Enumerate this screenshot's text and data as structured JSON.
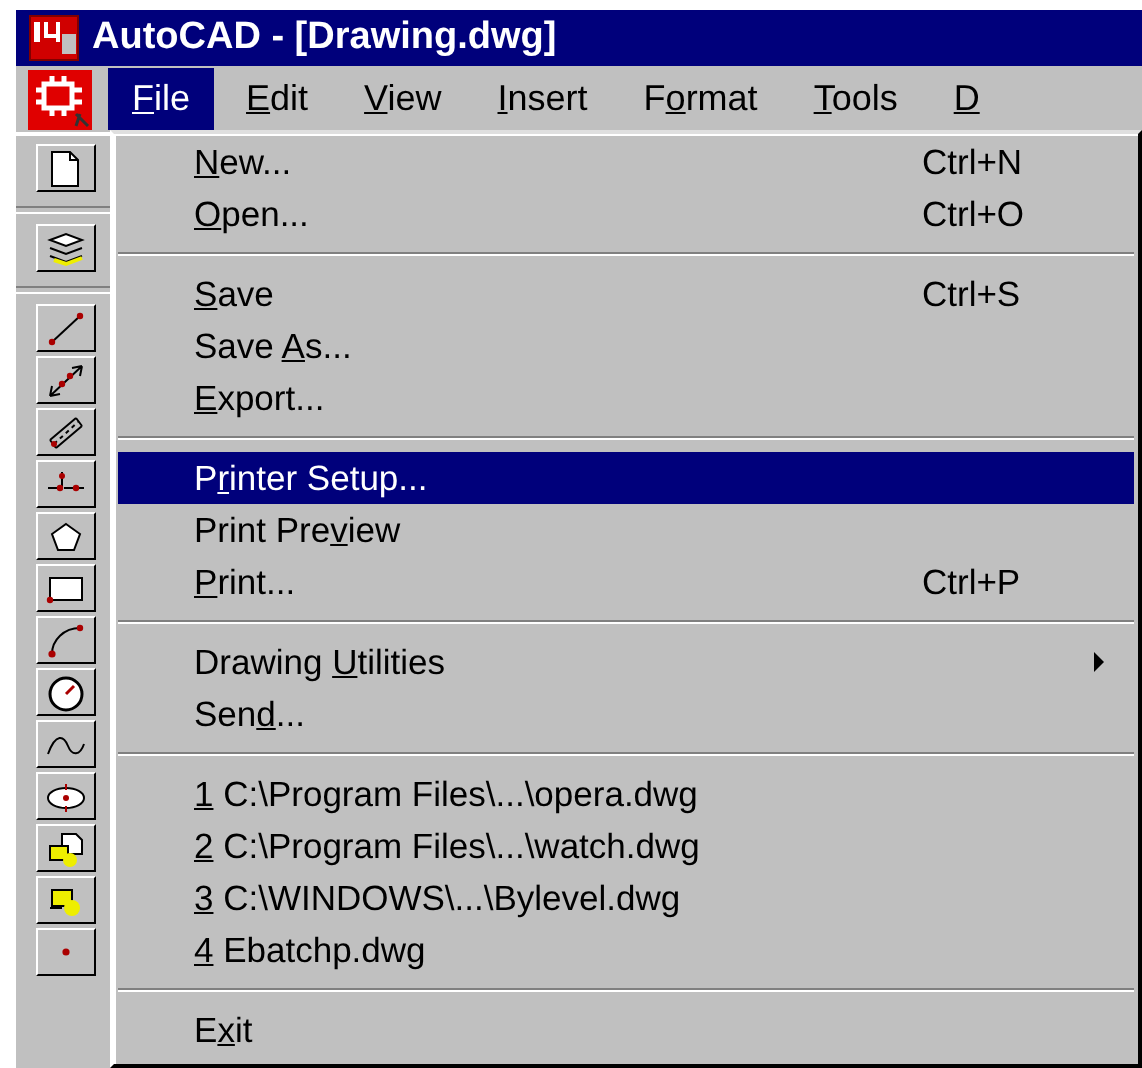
{
  "window": {
    "title": "AutoCAD - [Drawing.dwg]"
  },
  "menu_bar": [
    {
      "label": {
        "key": "F",
        "after": "ile"
      },
      "selected": true
    },
    {
      "label": {
        "key": "E",
        "after": "dit"
      },
      "selected": false
    },
    {
      "label": {
        "key": "V",
        "after": "iew"
      },
      "selected": false
    },
    {
      "label": {
        "key": "I",
        "after": "nsert"
      },
      "selected": false
    },
    {
      "label": {
        "before": "F",
        "key": "o",
        "after": "rmat"
      },
      "selected": false
    },
    {
      "label": {
        "key": "T",
        "after": "ools"
      },
      "selected": false
    },
    {
      "label": {
        "key": "D"
      },
      "selected": false
    }
  ],
  "file_menu": [
    {
      "kind": "item",
      "label": {
        "key": "N",
        "after": "ew..."
      },
      "shortcut": "Ctrl+N",
      "selected": false
    },
    {
      "kind": "item",
      "label": {
        "key": "O",
        "after": "pen..."
      },
      "shortcut": "Ctrl+O",
      "selected": false
    },
    {
      "kind": "separator"
    },
    {
      "kind": "item",
      "label": {
        "key": "S",
        "after": "ave"
      },
      "shortcut": "Ctrl+S",
      "selected": false
    },
    {
      "kind": "item",
      "label": {
        "before": "Save ",
        "key": "A",
        "after": "s..."
      },
      "selected": false
    },
    {
      "kind": "item",
      "label": {
        "key": "E",
        "after": "xport..."
      },
      "selected": false
    },
    {
      "kind": "separator"
    },
    {
      "kind": "item",
      "label": {
        "before": "P",
        "key": "r",
        "after": "inter Setup..."
      },
      "selected": true
    },
    {
      "kind": "item",
      "label": {
        "before": "Print Pre",
        "key": "v",
        "after": "iew"
      },
      "selected": false
    },
    {
      "kind": "item",
      "label": {
        "key": "P",
        "after": "rint..."
      },
      "shortcut": "Ctrl+P",
      "selected": false
    },
    {
      "kind": "separator"
    },
    {
      "kind": "submenu",
      "label": {
        "before": "Drawing ",
        "key": "U",
        "after": "tilities"
      },
      "selected": false
    },
    {
      "kind": "item",
      "label": {
        "before": "Sen",
        "key": "d",
        "after": "..."
      },
      "selected": false
    },
    {
      "kind": "separator"
    },
    {
      "kind": "item",
      "label": {
        "key": "1",
        "after": " C:\\Program Files\\...\\opera.dwg"
      },
      "selected": false
    },
    {
      "kind": "item",
      "label": {
        "key": "2",
        "after": " C:\\Program Files\\...\\watch.dwg"
      },
      "selected": false
    },
    {
      "kind": "item",
      "label": {
        "key": "3",
        "after": " C:\\WINDOWS\\...\\Bylevel.dwg"
      },
      "selected": false
    },
    {
      "kind": "item",
      "label": {
        "key": "4",
        "after": " Ebatchp.dwg"
      },
      "selected": false
    },
    {
      "kind": "separator"
    },
    {
      "kind": "item",
      "label": {
        "before": "E",
        "key": "x",
        "after": "it"
      },
      "selected": false
    }
  ]
}
